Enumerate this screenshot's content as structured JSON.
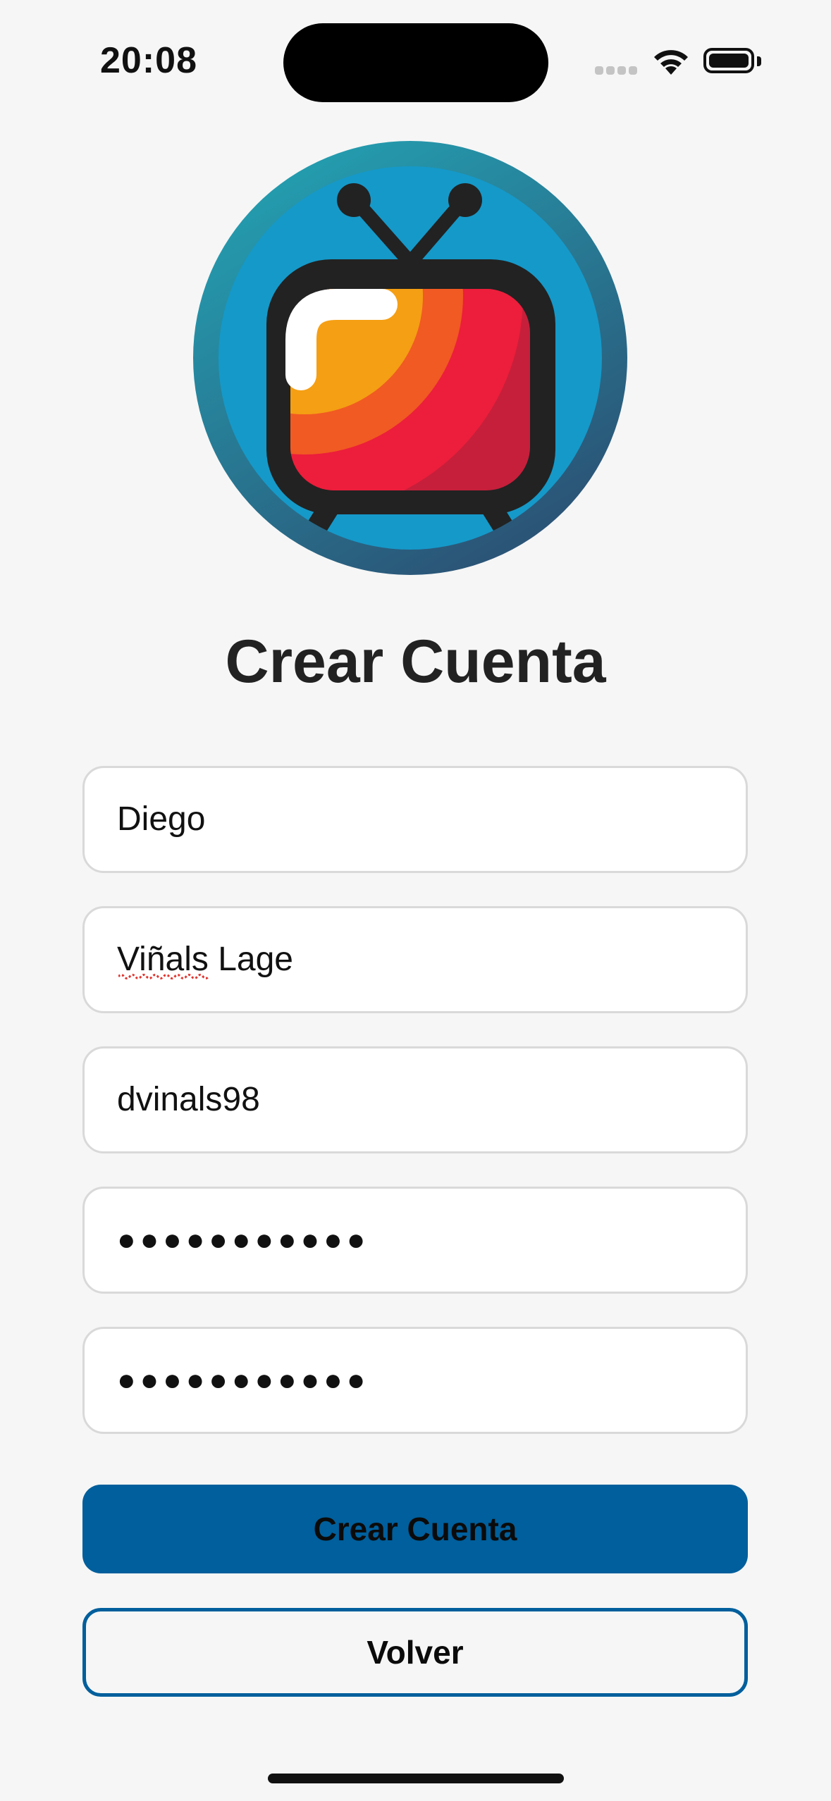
{
  "status_bar": {
    "time": "20:08",
    "icons": [
      "cellular-signal-icon",
      "wifi-icon",
      "battery-icon"
    ]
  },
  "logo": {
    "icon": "retro-tv-icon"
  },
  "title": "Crear Cuenta",
  "form": {
    "fields": [
      {
        "value": "Diego"
      },
      {
        "value": "Viñals Lage"
      },
      {
        "value": "dvinals98"
      },
      {
        "value": "●●●●●●●●●●●"
      },
      {
        "value": "●●●●●●●●●●●"
      }
    ]
  },
  "buttons": {
    "primary_label": "Crear Cuenta",
    "secondary_label": "Volver"
  },
  "colors": {
    "background": "#f6f6f6",
    "accent": "#005f9c",
    "text": "#222222"
  }
}
